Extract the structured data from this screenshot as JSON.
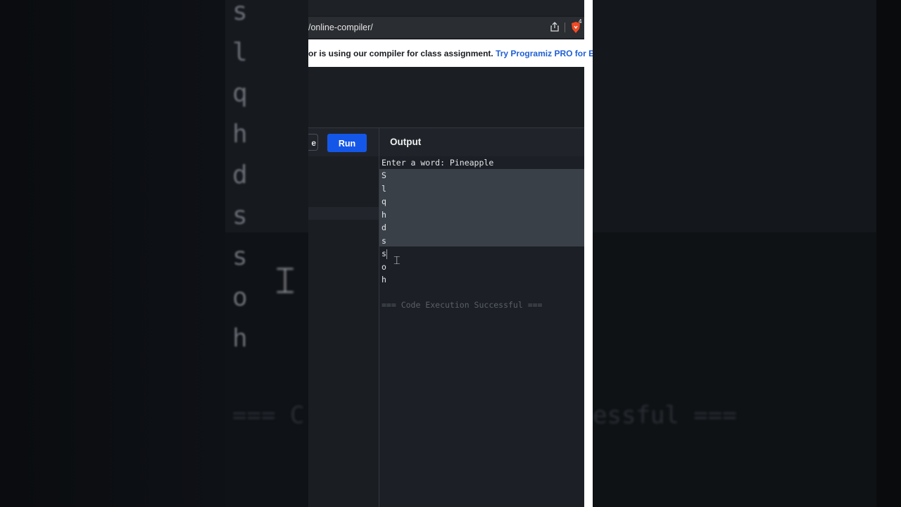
{
  "browser": {
    "url": "/online-compiler/",
    "extension_count": "4"
  },
  "banner": {
    "text": "or is using our compiler for class assignment. ",
    "link": "Try Programiz PRO for Educ"
  },
  "toolbar": {
    "save_label_partial": "e",
    "run_label": "Run",
    "output_title": "Output"
  },
  "output": {
    "prompt_line": "Enter a word: Pineapple",
    "lines": [
      "S",
      "l",
      "q",
      "h",
      "d",
      "s",
      "s",
      "o",
      "h"
    ],
    "status": "=== Code Execution Successful ==="
  },
  "background_echo": {
    "letters": [
      "s",
      "l",
      "q",
      "h",
      "d",
      "s",
      "s",
      "o",
      "h"
    ],
    "status_left": "=== C",
    "status_right": "essful ==="
  }
}
